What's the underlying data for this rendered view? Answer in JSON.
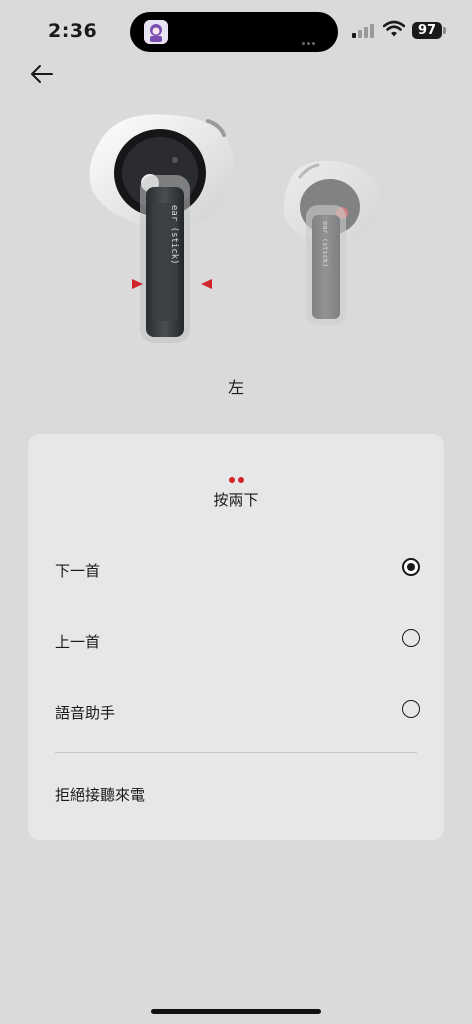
{
  "status_bar": {
    "time": "2:36",
    "battery": "97"
  },
  "earbud": {
    "left_brand_text": "ear (stick)",
    "right_brand_text": "ear (stick)"
  },
  "side_label": "左",
  "gesture": {
    "title": "按兩下",
    "options": [
      {
        "label": "下一首",
        "selected": true
      },
      {
        "label": "上一首",
        "selected": false
      },
      {
        "label": "語音助手",
        "selected": false
      }
    ],
    "extra_option": "拒絕接聽來電"
  },
  "colors": {
    "background": "#d9dad9",
    "card": "#e6e7e6",
    "accent_red": "#d0262a"
  }
}
